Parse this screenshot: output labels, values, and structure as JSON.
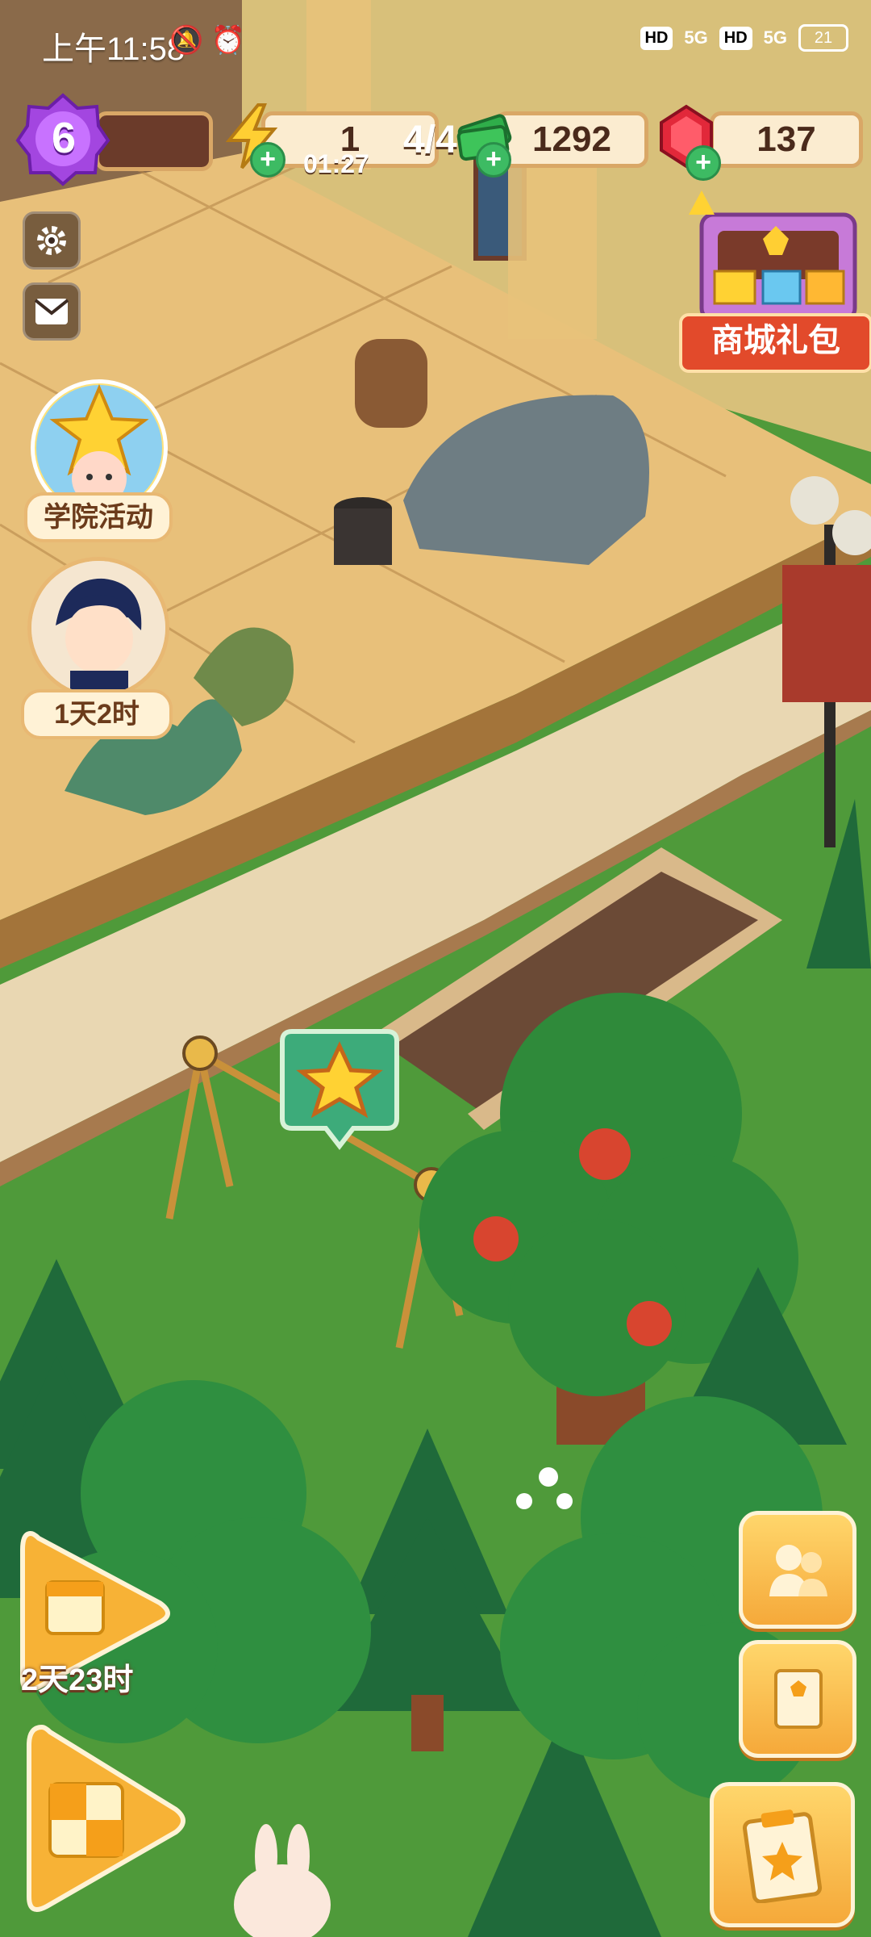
{
  "status_bar": {
    "time": "上午11:58",
    "network_1": "5G",
    "network_2": "5G",
    "battery": "21"
  },
  "resources": {
    "level": "6",
    "energy": "1",
    "energy_timer": "01:27",
    "energy_cap": "4/4",
    "cash": "1292",
    "gems": "137"
  },
  "events": {
    "academy_activity": "学院活动",
    "character_timer": "1天2时",
    "calendar_timer": "2天23时"
  },
  "shop": {
    "label": "商城礼包"
  },
  "colors": {
    "grass": "#4f9a3a",
    "accent_yellow": "#f5a93a",
    "plus_green": "#3dbb63",
    "gem_red": "#e2283a",
    "level_purple": "#9b3fd8"
  },
  "icons": [
    "settings-gear-icon",
    "mail-icon",
    "energy-bolt-icon",
    "cash-icon",
    "gem-icon",
    "star-icon",
    "character-icon",
    "book-icon",
    "task-clipboard-icon",
    "calendar-icon",
    "puzzle-icon"
  ]
}
